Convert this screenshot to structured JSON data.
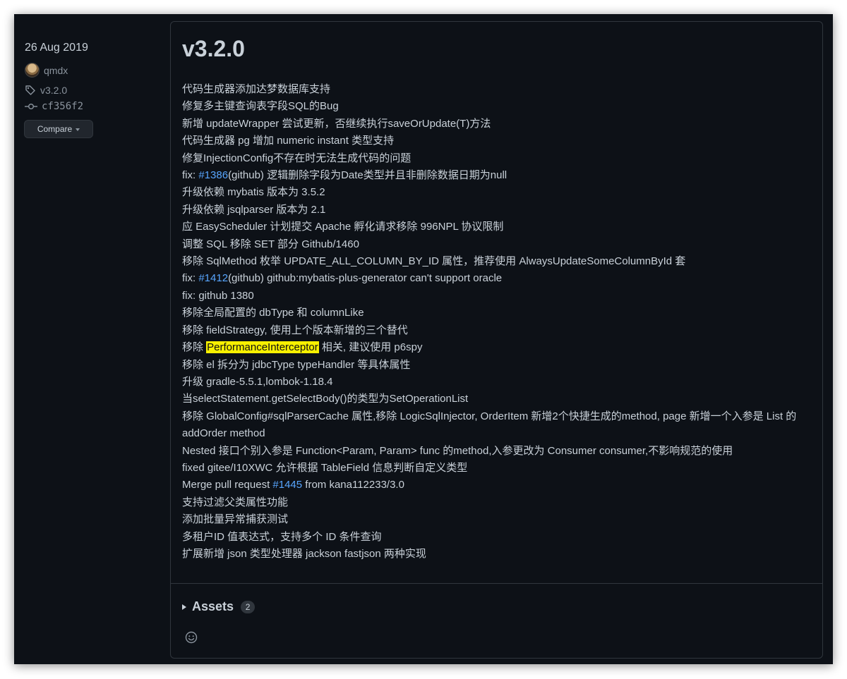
{
  "sidebar": {
    "date": "26 Aug 2019",
    "author": "qmdx",
    "tag": "v3.2.0",
    "commit": "cf356f2",
    "compare_label": "Compare"
  },
  "release": {
    "title": "v3.2.0",
    "notes": [
      {
        "text": "代码生成器添加达梦数据库支持"
      },
      {
        "text": "修复多主键查询表字段SQL的Bug"
      },
      {
        "text": "新增 updateWrapper 尝试更新，否继续执行saveOrUpdate(T)方法"
      },
      {
        "text": "代码生成器 pg 增加 numeric instant 类型支持"
      },
      {
        "text": "修复InjectionConfig不存在时无法生成代码的问题"
      },
      {
        "pre": "fix: ",
        "link": "#1386",
        "post": "(github) 逻辑删除字段为Date类型并且非删除数据日期为null"
      },
      {
        "text": "升级依赖 mybatis 版本为 3.5.2"
      },
      {
        "text": "升级依赖 jsqlparser 版本为 2.1"
      },
      {
        "text": "应 EasyScheduler 计划提交 Apache 孵化请求移除 996NPL 协议限制"
      },
      {
        "text": "调整 SQL 移除 SET 部分 Github/1460"
      },
      {
        "text": "移除 SqlMethod 枚举 UPDATE_ALL_COLUMN_BY_ID 属性，推荐使用 AlwaysUpdateSomeColumnById 套"
      },
      {
        "pre": "fix: ",
        "link": "#1412",
        "post": "(github) github:mybatis-plus-generator can't support oracle"
      },
      {
        "text": "fix: github 1380"
      },
      {
        "text": "移除全局配置的 dbType 和 columnLike"
      },
      {
        "text": "移除 fieldStrategy, 使用上个版本新增的三个替代"
      },
      {
        "pre": "移除 ",
        "highlight": "PerformanceInterceptor",
        "post": " 相关, 建议使用 p6spy"
      },
      {
        "text": "移除 el 拆分为 jdbcType typeHandler 等具体属性"
      },
      {
        "text": "升级 gradle-5.5.1,lombok-1.18.4"
      },
      {
        "text": "当selectStatement.getSelectBody()的类型为SetOperationList"
      },
      {
        "text": "移除 GlobalConfig#sqlParserCache 属性,移除 LogicSqlInjector, OrderItem 新增2个快捷生成的method, page 新增一个入参是 List 的 addOrder method",
        "wrap": true
      },
      {
        "text": "Nested 接口个别入参是 Function<Param, Param> func 的method,入参更改为 Consumer consumer,不影响规范的使用"
      },
      {
        "text": "fixed gitee/I10XWC 允许根据 TableField 信息判断自定义类型"
      },
      {
        "pre": "Merge pull request ",
        "link": "#1445",
        "post": " from kana112233/3.0"
      },
      {
        "text": "支持过滤父类属性功能"
      },
      {
        "text": "添加批量异常捕获测试"
      },
      {
        "text": "多租户ID 值表达式，支持多个 ID 条件查询"
      },
      {
        "text": "扩展新增 json 类型处理器 jackson fastjson 两种实现"
      }
    ],
    "assets_label": "Assets",
    "assets_count": "2"
  },
  "colors": {
    "background": "#0d1117",
    "border": "#30363d",
    "text": "#c9d1d9",
    "muted": "#8b949e",
    "link": "#58a6ff",
    "highlight": "#f8f000"
  },
  "icons": [
    "avatar",
    "tag-icon",
    "git-commit-icon",
    "chevron-down-icon",
    "disclosure-triangle-icon",
    "smiley-icon"
  ]
}
